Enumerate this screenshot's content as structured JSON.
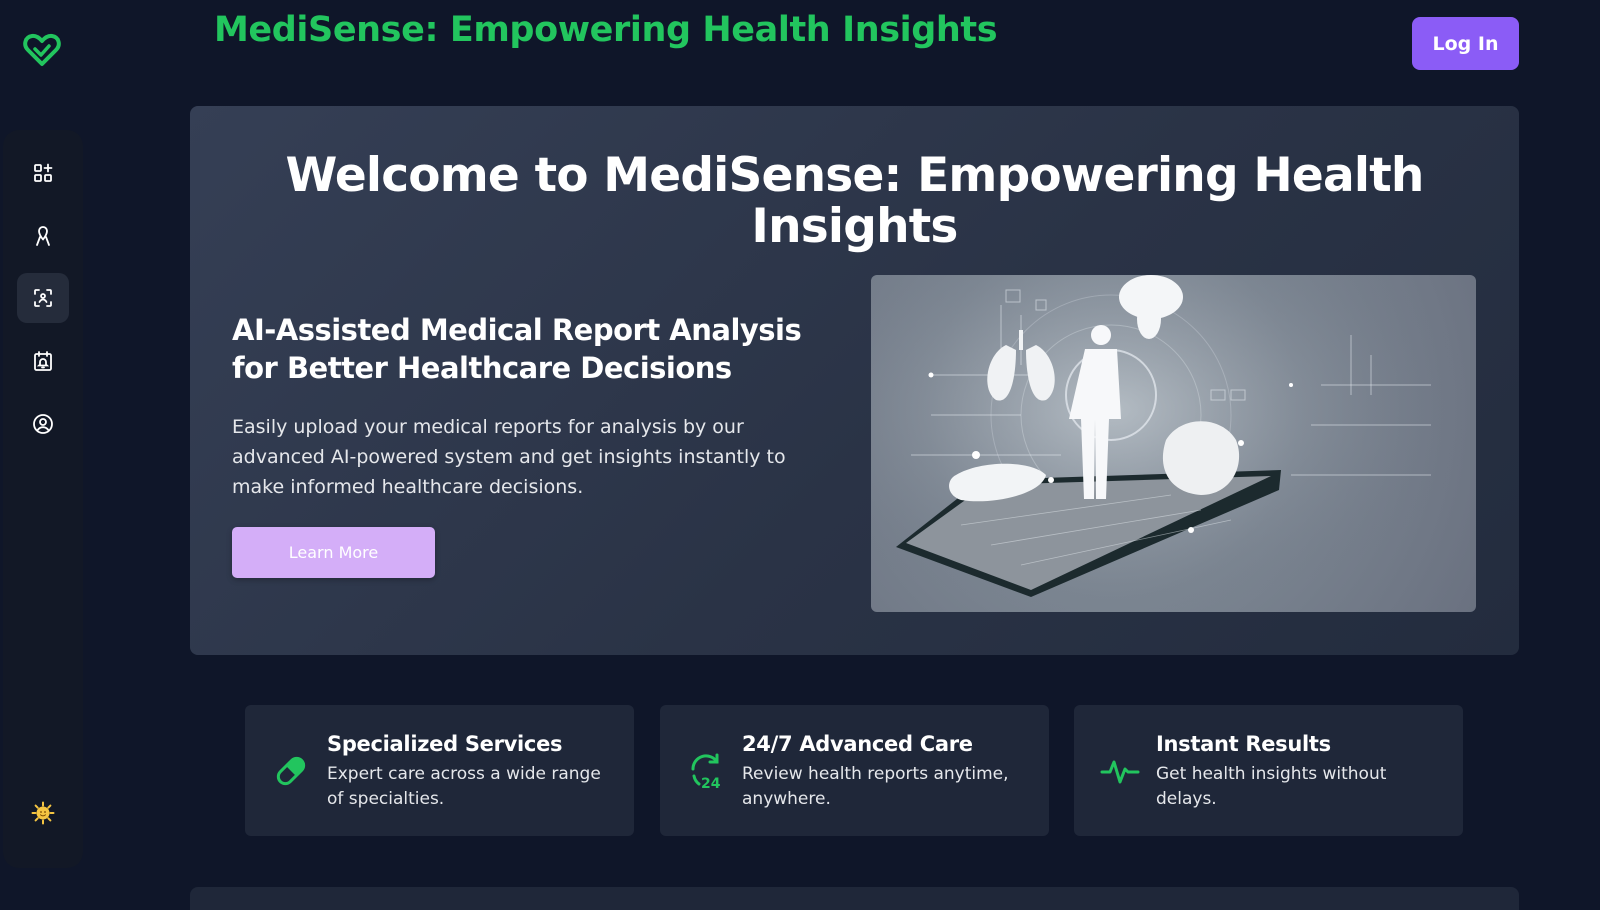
{
  "app": {
    "title": "MediSense: Empowering Health Insights",
    "login_label": "Log In",
    "accent_color": "#22c55e",
    "login_color": "#8b5cf6"
  },
  "sidebar": {
    "logo_icon": "heart-logo-icon",
    "items": [
      {
        "icon": "dashboard-add-icon",
        "active": false
      },
      {
        "icon": "ribbon-icon",
        "active": false
      },
      {
        "icon": "scan-icon",
        "active": true
      },
      {
        "icon": "calendar-alert-icon",
        "active": false
      },
      {
        "icon": "user-circle-icon",
        "active": false
      }
    ],
    "theme_icon": "sun-face-icon"
  },
  "hero": {
    "title": "Welcome to MediSense: Empowering Health Insights",
    "subtitle": "AI-Assisted Medical Report Analysis for Better Healthcare Decisions",
    "description": "Easily upload your medical reports for analysis by our advanced AI-powered system and get insights instantly to make informed healthcare decisions.",
    "cta_label": "Learn More",
    "cta_color": "#d4aef8"
  },
  "features": [
    {
      "icon": "pill-icon",
      "title": "Specialized Services",
      "description": "Expert care across a wide range of specialties."
    },
    {
      "icon": "clock-24-icon",
      "title": "24/7 Advanced Care",
      "description": "Review health reports anytime, anywhere."
    },
    {
      "icon": "pulse-icon",
      "title": "Instant Results",
      "description": "Get health insights without delays."
    }
  ]
}
